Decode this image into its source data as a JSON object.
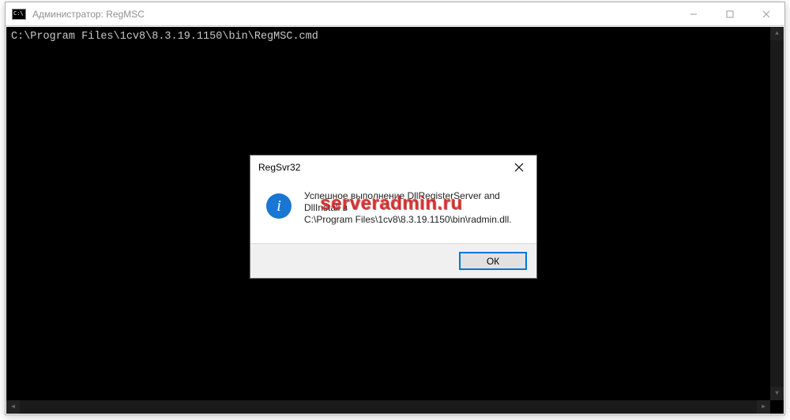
{
  "console": {
    "title": "Администратор:  RegMSC",
    "command_line": "C:\\Program Files\\1cv8\\8.3.19.1150\\bin\\RegMSC.cmd"
  },
  "dialog": {
    "title": "RegSvr32",
    "message_line1": "Успешное выполнение DllRegisterServer and DllInstall в",
    "message_line2": "C:\\Program Files\\1cv8\\8.3.19.1150\\bin\\radmin.dll.",
    "ok_label": "ОК"
  },
  "watermark": "serveradmin.ru"
}
